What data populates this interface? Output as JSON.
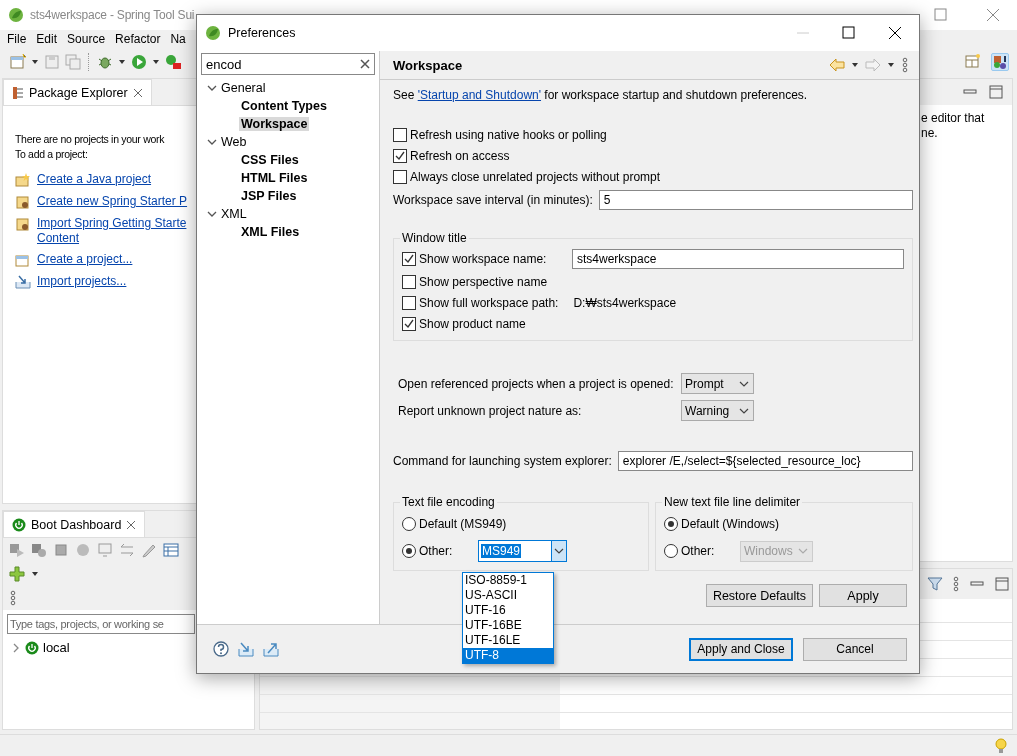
{
  "ide": {
    "title": "sts4werkspace - Spring Tool Sui",
    "menu": [
      "File",
      "Edit",
      "Source",
      "Refactor",
      "Na"
    ],
    "package_explorer": {
      "tab": "Package Explorer",
      "message": [
        "There are no projects in your work",
        "To add a project:"
      ],
      "links": [
        {
          "lines": [
            "Create a Java project"
          ]
        },
        {
          "lines": [
            "Create new Spring Starter P"
          ]
        },
        {
          "lines": [
            "Import Spring Getting Starte",
            "Content"
          ]
        },
        {
          "lines": [
            "Create a project..."
          ]
        },
        {
          "lines": [
            "Import projects..."
          ]
        }
      ]
    },
    "editor_hint": [
      "e editor that",
      "ne."
    ],
    "boot_dashboard": {
      "tab": "Boot Dashboard",
      "filter_placeholder": "Type tags, projects, or working se",
      "items": [
        {
          "label": "local",
          "expanded": false
        }
      ]
    }
  },
  "dialog": {
    "title": "Preferences",
    "search": {
      "value": "encod"
    },
    "tree": [
      {
        "label": "General",
        "expanded": true,
        "children": [
          {
            "label": "Content Types",
            "selected": false
          },
          {
            "label": "Workspace",
            "selected": true
          }
        ]
      },
      {
        "label": "Web",
        "expanded": true,
        "children": [
          {
            "label": "CSS Files",
            "selected": false
          },
          {
            "label": "HTML Files",
            "selected": false
          },
          {
            "label": "JSP Files",
            "selected": false
          }
        ]
      },
      {
        "label": "XML",
        "expanded": true,
        "children": [
          {
            "label": "XML Files",
            "selected": false
          }
        ]
      }
    ],
    "page": {
      "title": "Workspace",
      "intro": {
        "before": "See ",
        "link": "'Startup and Shutdown'",
        "after": " for workspace startup and shutdown preferences."
      },
      "options": [
        {
          "label": "Refresh using native hooks or polling",
          "checked": false
        },
        {
          "label": "Refresh on access",
          "checked": true
        },
        {
          "label": "Always close unrelated projects without prompt",
          "checked": false
        }
      ],
      "save_interval": {
        "label": "Workspace save interval (in minutes):",
        "value": "5"
      },
      "window_title": {
        "legend": "Window title",
        "rows": [
          {
            "kind": "field",
            "label": "Show workspace name:",
            "checked": true,
            "value": "sts4werkspace"
          },
          {
            "kind": "plain",
            "label": "Show perspective name",
            "checked": false
          },
          {
            "kind": "path",
            "label": "Show full workspace path:",
            "checked": false,
            "value": "D:₩sts4werkspace"
          },
          {
            "kind": "plain",
            "label": "Show product name",
            "checked": true
          }
        ]
      },
      "choices": [
        {
          "label": "Open referenced projects when a project is opened:",
          "value": "Prompt"
        },
        {
          "label": "Report unknown project nature as:",
          "value": "Warning"
        }
      ],
      "explorer_command": {
        "label": "Command for launching system explorer:",
        "value": "explorer /E,/select=${selected_resource_loc}"
      },
      "encoding": {
        "legend": "Text file encoding",
        "options": [
          {
            "label": "Default (MS949)",
            "selected": false
          },
          {
            "label": "Other:",
            "selected": true,
            "combo": {
              "value": "MS949",
              "disabled": false,
              "open": true
            }
          }
        ],
        "popup": [
          {
            "label": "ISO-8859-1",
            "selected": false
          },
          {
            "label": "US-ASCII",
            "selected": false
          },
          {
            "label": "UTF-16",
            "selected": false
          },
          {
            "label": "UTF-16BE",
            "selected": false
          },
          {
            "label": "UTF-16LE",
            "selected": false
          },
          {
            "label": "UTF-8",
            "selected": true
          }
        ]
      },
      "line_delimiter": {
        "legend": "New text file line delimiter",
        "options": [
          {
            "label": "Default (Windows)",
            "selected": true
          },
          {
            "label": "Other:",
            "selected": false,
            "combo": {
              "value": "Windows",
              "disabled": true,
              "open": false
            }
          }
        ]
      },
      "buttons": [
        {
          "label": "Restore Defaults"
        },
        {
          "label": "Apply"
        }
      ]
    },
    "footer_buttons": [
      {
        "label": "Apply and Close",
        "default": true
      },
      {
        "label": "Cancel",
        "default": false
      }
    ]
  }
}
